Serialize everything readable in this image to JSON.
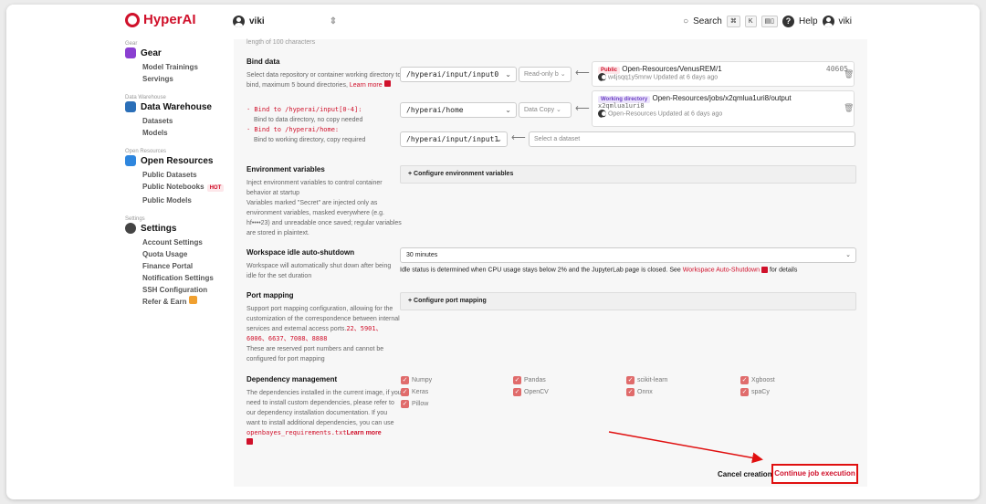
{
  "app": {
    "brand": "HyperAI",
    "brand_color": "#d0112b"
  },
  "topbar": {
    "workspace": "viki",
    "search_label": "Search",
    "kbd1": "⌘",
    "kbd2": "K",
    "help_label": "Help",
    "user": "viki"
  },
  "sidebar": {
    "cut_top": "Gear",
    "gear": {
      "sub": "",
      "title": "Gear",
      "items": [
        "Model Trainings",
        "Servings"
      ]
    },
    "warehouse": {
      "sub": "Data Warehouse",
      "title": "Data Warehouse",
      "items": [
        "Datasets",
        "Models"
      ]
    },
    "open": {
      "sub": "Open Resources",
      "title": "Open Resources",
      "items": [
        "Public Datasets",
        "Public Notebooks",
        "Public Models"
      ],
      "hot": "HOT"
    },
    "settings": {
      "sub": "Settings",
      "title": "Settings",
      "items": [
        "Account Settings",
        "Quota Usage",
        "Finance Portal",
        "Notification Settings",
        "SSH Configuration",
        "Refer & Earn"
      ]
    }
  },
  "main": {
    "cut_text": "length of 100 characters",
    "bind": {
      "title": "Bind data",
      "desc1": "Select data repository or container working directory to bind, maximum 5 bound directories,",
      "learn": "Learn more",
      "hint1_code": "· Bind to /hyperai/input[0-4]:",
      "hint1_text": "Bind to data directory, no copy needed",
      "hint2_code": "· Bind to /hyperai/home:",
      "hint2_text": "Bind to working directory, copy required",
      "rows": [
        {
          "path": "/hyperai/input/input0",
          "mode": "Read-only b"
        },
        {
          "path": "/hyperai/home",
          "mode": "Data Copy"
        },
        {
          "path": "/hyperai/input/input1",
          "placeholder": "Select a dataset"
        }
      ],
      "card1": {
        "badge": "Public",
        "name": "Open-Resources/VenusREM/1",
        "size": "40605",
        "meta": "w4jsqq1y5mnw Updated at 6 days ago"
      },
      "card2": {
        "badge": "Working directory",
        "name": "Open-Resources/jobs/x2qmlua1uri8/output",
        "code": "x2qmlua1uri8",
        "meta": "Open-Resources Updated at 6 days ago"
      }
    },
    "env": {
      "title": "Environment variables",
      "desc": "Inject environment variables to control container behavior at startup\nVariables marked \"Secret\" are injected only as environment variables, masked everywhere (e.g. hf••••23) and unreadable once saved; regular variables are stored in plaintext.",
      "button": "+ Configure environment variables"
    },
    "idle": {
      "title": "Workspace idle auto-shutdown",
      "desc": "Workspace will automatically shut down after being idle for the set duration",
      "value": "30 minutes",
      "note": "Idle status is determined when CPU usage stays below 2% and the JupyterLab page is closed. See",
      "link": "Workspace Auto-Shutdown",
      "note_end": "for details"
    },
    "port": {
      "title": "Port mapping",
      "desc1": "Support port mapping configuration, allowing for the customization of the correspondence between internal services and external access ports.",
      "ports": "22、5901、6006、6637、7088、8888",
      "desc2": "These are reserved port numbers and cannot be configured for port mapping",
      "button": "+ Configure port mapping"
    },
    "deps": {
      "title": "Dependency management",
      "desc": "The dependencies installed in the current image, if you need to install custom dependencies, please refer to our dependency installation documentation. If you want to install additional dependencies, you can use",
      "file": "openbayes_requirements.txt",
      "learn": "Learn more",
      "items": [
        "Numpy",
        "Pandas",
        "scikit-learn",
        "Xgboost",
        "Keras",
        "OpenCV",
        "Onnx",
        "spaCy",
        "Pillow"
      ]
    },
    "actions": {
      "cancel": "Cancel creation",
      "continue": "Continue job execution"
    }
  }
}
